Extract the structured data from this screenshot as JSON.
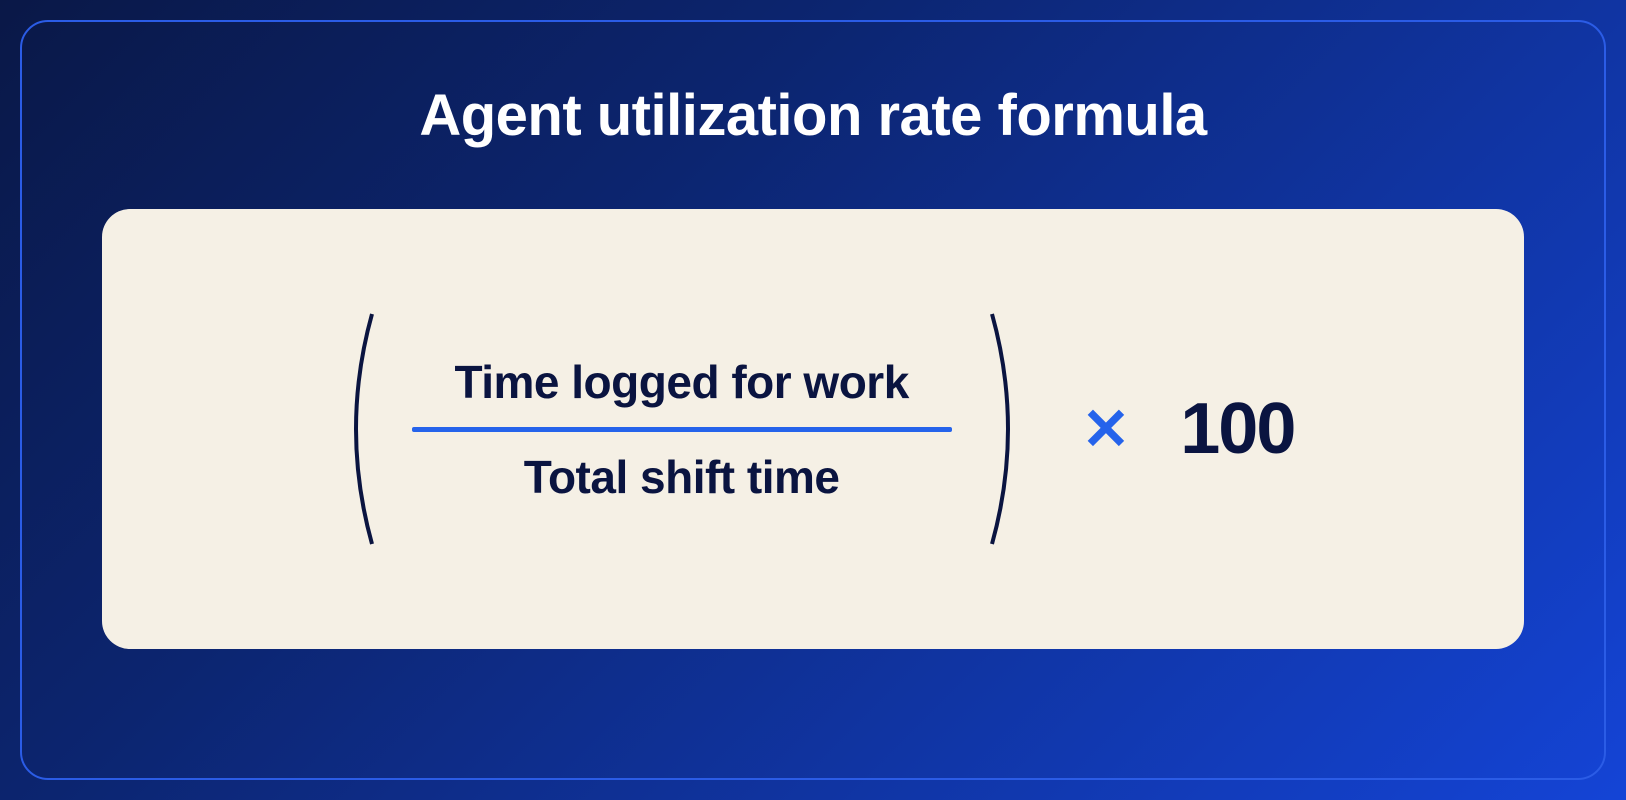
{
  "title": "Agent utilization rate formula",
  "formula": {
    "numerator": "Time logged for work",
    "denominator": "Total shift time",
    "multiply_symbol": "✕",
    "multiplier": "100"
  },
  "colors": {
    "accent_blue": "#2563eb",
    "dark_navy": "#0a1440",
    "card_bg": "#f5f0e5"
  }
}
